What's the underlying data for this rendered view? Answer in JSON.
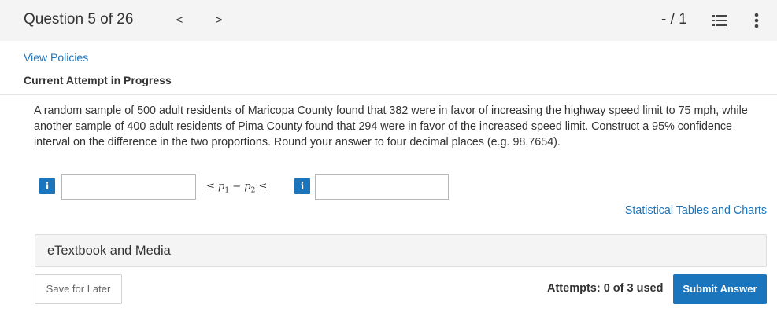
{
  "header": {
    "question_counter": "Question 5 of 26",
    "prev_label": "<",
    "next_label": ">",
    "score": "- / 1",
    "list_icon": "list-icon",
    "more_icon": "more-vertical-icon"
  },
  "links": {
    "view_policies": "View Policies",
    "stat_tables": "Statistical Tables and Charts"
  },
  "status": {
    "heading": "Current Attempt in Progress"
  },
  "question": {
    "text": "A random sample of 500 adult residents of Maricopa County found that 382 were in favor of increasing the highway speed limit to 75 mph, while another sample of 400 adult residents of Pima County found that 294 were in favor of the increased speed limit. Construct a 95% confidence interval on the difference in the two proportions. Round your answer to four decimal places (e.g. 98.7654)."
  },
  "answer": {
    "info_label": "i",
    "lower_value": "",
    "upper_value": "",
    "inequality_left": "≤",
    "p1": "p",
    "sub1": "1",
    "minus": "−",
    "p2": "p",
    "sub2": "2",
    "inequality_right": "≤"
  },
  "resources": {
    "etextbook_label": "eTextbook and Media"
  },
  "footer": {
    "save_label": "Save for Later",
    "attempts_text": "Attempts: 0 of 3 used",
    "submit_label": "Submit Answer"
  },
  "colors": {
    "accent": "#1b75bc",
    "background": "#f4f4f4",
    "card": "#ffffff"
  }
}
